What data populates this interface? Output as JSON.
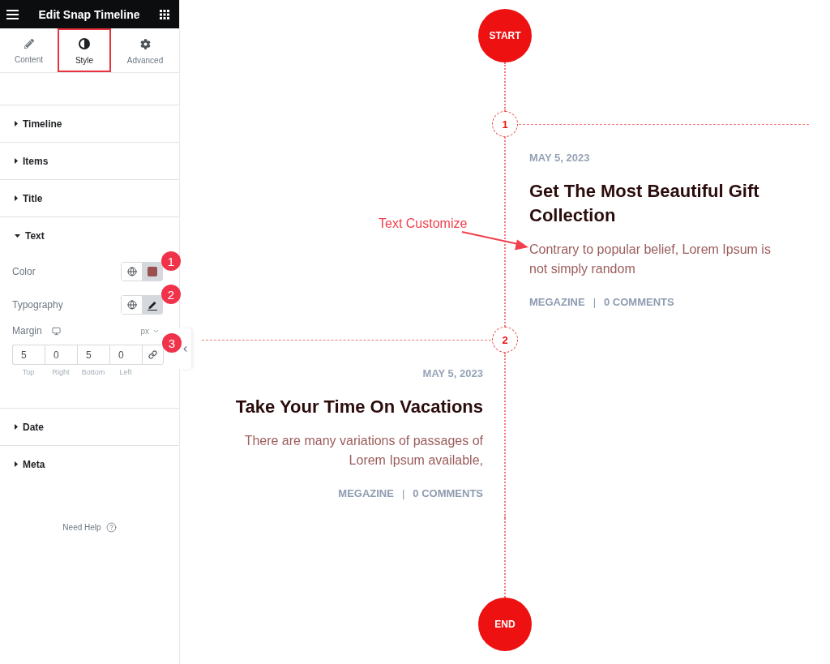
{
  "panel": {
    "title": "Edit Snap Timeline",
    "tabs": [
      {
        "label": "Content",
        "selected": false
      },
      {
        "label": "Style",
        "selected": true
      },
      {
        "label": "Advanced",
        "selected": false
      }
    ],
    "sections": [
      {
        "label": "Timeline",
        "expanded": false
      },
      {
        "label": "Items",
        "expanded": false
      },
      {
        "label": "Title",
        "expanded": false
      },
      {
        "label": "Text",
        "expanded": true,
        "controls": [
          {
            "kind": "color",
            "label": "Color",
            "color": "#9b4f4f",
            "badge": "1"
          },
          {
            "kind": "typography",
            "label": "Typography",
            "edited": true,
            "badge": "2"
          },
          {
            "kind": "dimensions",
            "label": "Margin",
            "unit": "px",
            "badge": "3",
            "fields": [
              {
                "value": "5",
                "label": "Top"
              },
              {
                "value": "0",
                "label": "Right"
              },
              {
                "value": "5",
                "label": "Bottom"
              },
              {
                "value": "0",
                "label": "Left"
              }
            ]
          }
        ]
      },
      {
        "label": "Date",
        "expanded": false
      },
      {
        "label": "Meta",
        "expanded": false
      }
    ],
    "help": "Need Help"
  },
  "timeline": {
    "start": "START",
    "end": "END",
    "items": [
      {
        "kind": "right",
        "marker": "1",
        "date": "MAY 5, 2023",
        "title": "Get The Most Beautiful Gift Collection",
        "text": "Contrary to popular belief, Lorem Ipsum is not simply random",
        "callout": "Text Customize",
        "meta": [
          "MEGAZINE",
          "0 COMMENTS"
        ],
        "separator": "|"
      },
      {
        "kind": "left",
        "marker": "2",
        "date": "MAY 5, 2023",
        "title": "Take Your Time On Vacations",
        "text": "There are many variations of passages of Lorem Ipsum available,",
        "meta": [
          "MEGAZINE",
          "0 COMMENTS"
        ],
        "separator": "|"
      }
    ]
  }
}
